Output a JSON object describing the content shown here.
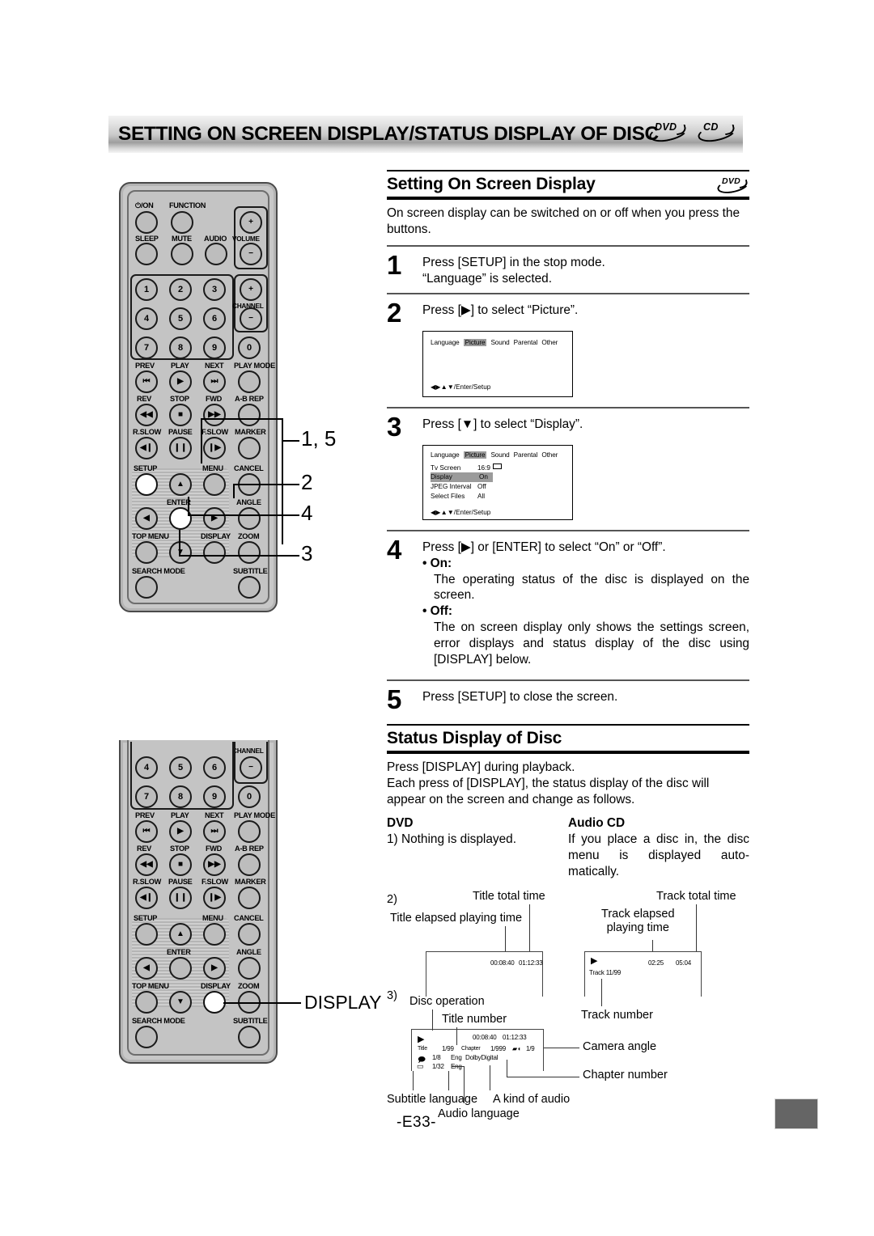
{
  "header": {
    "title": "SETTING ON SCREEN DISPLAY/STATUS DISPLAY OF DISC",
    "logos": [
      "DVD",
      "CD"
    ]
  },
  "section1": {
    "title": "Setting On Screen Display",
    "badge": "DVD",
    "intro": "On screen display can be switched on or off when you press the buttons.",
    "steps": [
      {
        "num": "1",
        "text": "Press [SETUP] in the stop mode.\n“Language” is selected."
      },
      {
        "num": "2",
        "text": "Press [▶] to select “Picture”."
      },
      {
        "num": "3",
        "text": "Press [▼] to select “Display”."
      },
      {
        "num": "4",
        "text": "Press [▶] or [ENTER] to select “On” or “Off”."
      },
      {
        "num": "5",
        "text": "Press [SETUP] to close the screen."
      }
    ],
    "step4_on_label": "• On:",
    "step4_on_text": "The operating status of the disc is displayed on the screen.",
    "step4_off_label": "• Off:",
    "step4_off_text": "The on screen display only shows the settings screen, error displays and status display of the disc using [DISPLAY] below."
  },
  "osd_menu_1": {
    "tabs": [
      "Language",
      "Picture",
      "Sound",
      "Parental",
      "Other"
    ],
    "selected_tab": "Picture",
    "nav_hint": "◀▶▲▼/Enter/Setup"
  },
  "osd_menu_2": {
    "tabs": [
      "Language",
      "Picture",
      "Sound",
      "Parental",
      "Other"
    ],
    "selected_tab": "Picture",
    "rows": [
      {
        "key": "Tv Screen",
        "value": "16:9",
        "icon": "screen-icon",
        "key_highlight": false,
        "value_highlight": false
      },
      {
        "key": "Display",
        "value": "On",
        "key_highlight": true,
        "value_highlight": true
      },
      {
        "key": "JPEG Interval",
        "value": "Off",
        "key_highlight": false,
        "value_highlight": false
      },
      {
        "key": "Select Files",
        "value": "All",
        "key_highlight": false,
        "value_highlight": false
      }
    ],
    "nav_hint": "◀▶▲▼/Enter/Setup"
  },
  "section2": {
    "title": "Status Display of Disc",
    "intro_line1": "Press [DISPLAY] during playback.",
    "intro_line2": "Each press of [DISPLAY], the status display of the disc will appear on the screen and change as follows.",
    "col_dvd_heading": "DVD",
    "col_cd_heading": "Audio CD",
    "dvd_item1": "1) Nothing is displayed.",
    "cd_item1": "If you place a disc in, the disc menu is displayed auto-matically.",
    "item2_marker": "2)",
    "item3_marker": "3)"
  },
  "fig_dvd_time": {
    "label_total": "Title total time",
    "label_elapsed": "Title elapsed playing time",
    "elapsed_value": "00:08:40",
    "total_value": "01:12:33"
  },
  "fig_cd_time": {
    "label_total": "Track total time",
    "label_elapsed": "Track elapsed\nplaying time",
    "label_track_number": "Track number",
    "play_glyph": "▶",
    "track_value": "Track 11/99",
    "elapsed_value": "02:25",
    "total_value": "05:04"
  },
  "fig_osd": {
    "label_disc_operation": "Disc operation",
    "label_title_number": "Title number",
    "label_camera_angle": "Camera angle",
    "label_chapter_number": "Chapter number",
    "label_subtitle_language": "Subtitle language",
    "label_audio_kind": "A kind of audio",
    "label_audio_language": "Audio language",
    "play_glyph": "▶",
    "time_elapsed": "00:08:40",
    "time_total": "01:12:33",
    "title_label": "Title",
    "title_value": "1/99",
    "chapter_label": "Chapter",
    "chapter_value": "1/999",
    "angle_value": "1/9",
    "audio_value": "1/8",
    "audio_lang": "Eng",
    "audio_format": "DolbyDigital",
    "subtitle_value": "1/32",
    "subtitle_lang": "Eng"
  },
  "remote1": {
    "labels": {
      "power": "⏻/ON",
      "function": "FUNCTION",
      "sleep": "SLEEP",
      "mute": "MUTE",
      "audio": "AUDIO",
      "volume": "VOLUME",
      "channel": "CHANNEL",
      "prev": "PREV",
      "play": "PLAY",
      "next": "NEXT",
      "play_mode": "PLAY MODE",
      "rev": "REV",
      "stop": "STOP",
      "fwd": "FWD",
      "ab_rep": "A-B REP",
      "r_slow": "R.SLOW",
      "pause": "PAUSE",
      "f_slow": "F.SLOW",
      "marker": "MARKER",
      "setup": "SETUP",
      "menu": "MENU",
      "cancel": "CANCEL",
      "enter": "ENTER",
      "angle": "ANGLE",
      "top_menu": "TOP MENU",
      "display": "DISPLAY",
      "zoom": "ZOOM",
      "search_mode": "SEARCH MODE",
      "subtitle": "SUBTITLE"
    },
    "numbers": [
      "1",
      "2",
      "3",
      "4",
      "5",
      "6",
      "7",
      "8",
      "9",
      "0"
    ],
    "plus": "+",
    "minus": "−"
  },
  "callouts": {
    "remote1": [
      "1, 5",
      "2",
      "4",
      "3"
    ],
    "remote2_display": "DISPLAY",
    "remote2_num": "3"
  },
  "footer": {
    "page": "-E33-"
  }
}
